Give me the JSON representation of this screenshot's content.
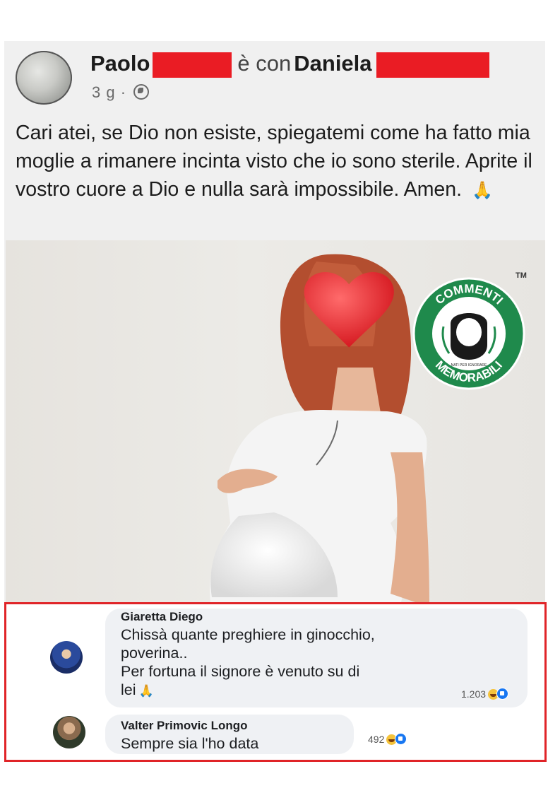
{
  "post": {
    "author": "Paolo",
    "with_word": "è con",
    "tagged": "Daniela",
    "time": "3 g",
    "separator": "·",
    "privacy_icon": "globe-icon",
    "text": "Cari atei, se Dio non esiste, spiegatemi come ha fatto mia moglie a rimanere incinta visto che io sono sterile. Aprite il vostro cuore a Dio e nulla sarà impossibile. Amen.",
    "emoji_icon": "praying-hands-icon",
    "image_desc_icon": "pregnant-woman-photo"
  },
  "watermark": {
    "top_text": "COMMENTI",
    "bottom_text": "MEMORABILI",
    "small_text": "NATI PER IGNORARE",
    "tm": "TM",
    "color": "#1f8a4c"
  },
  "comments": [
    {
      "author": "Giaretta Diego",
      "lines": [
        "Chissà quante preghiere in ginocchio,",
        "poverina..",
        "Per fortuna il signore è venuto su di",
        "lei"
      ],
      "reactions": "1.203"
    },
    {
      "author": "Valter Primovic Longo",
      "lines": [
        "Sempre sia l'ho data"
      ],
      "reactions": "492"
    }
  ],
  "colors": {
    "redaction": "#ea1c24",
    "highlight_border": "#e02428",
    "like_blue": "#1877f2",
    "haha_yellow": "#f5c33b"
  }
}
